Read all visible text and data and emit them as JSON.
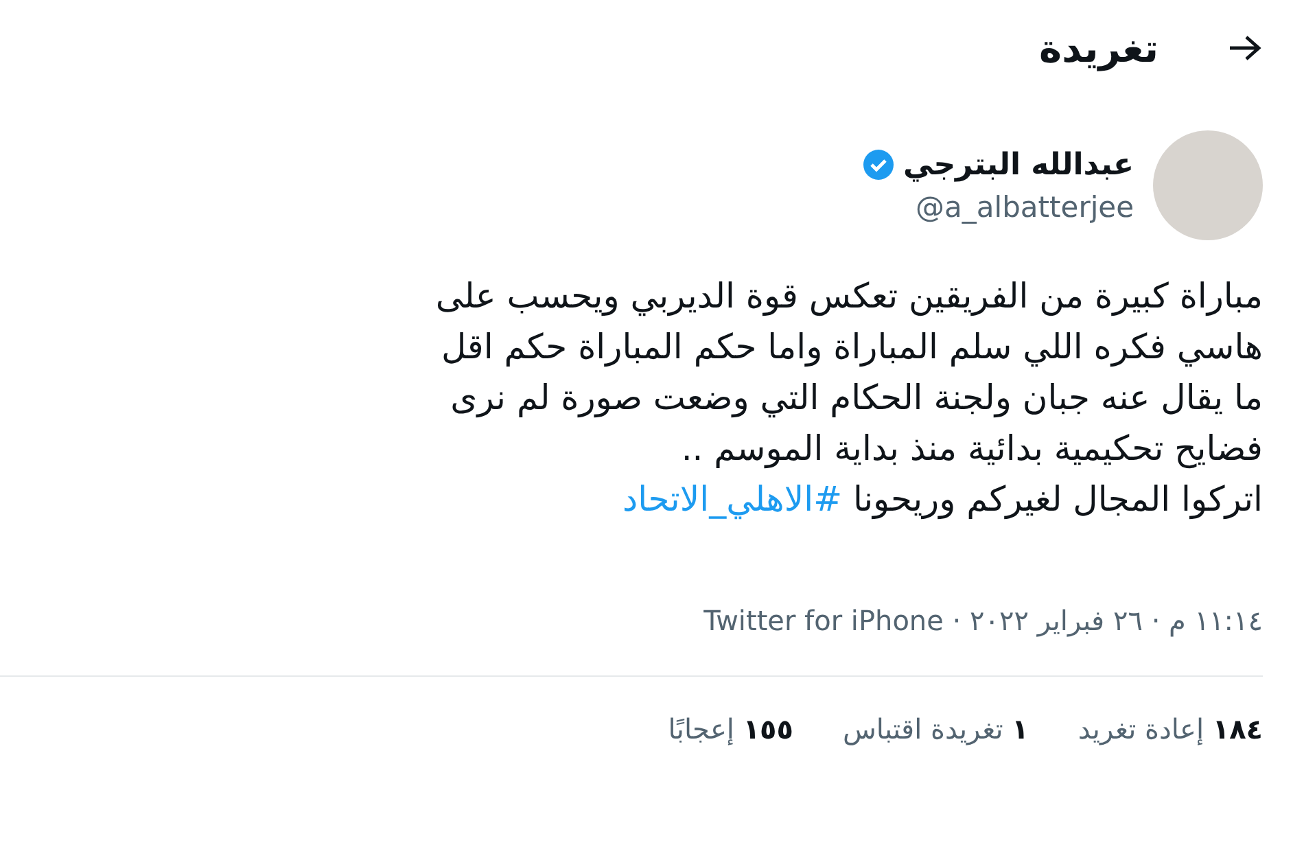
{
  "header": {
    "title": "تغريدة"
  },
  "author": {
    "name": "عبدالله البترجي",
    "handle": "@a_albatterjee",
    "verified": true
  },
  "tweet": {
    "lines": [
      "مباراة كبيرة من الفريقين تعكس قوة الديربي ويحسب على",
      "هاسي فكره اللي سلم المباراة واما حكم المباراة حكم اقل",
      "ما يقال عنه جبان ولجنة الحكام التي وضعت صورة لم نرى",
      "فضايح تحكيمية بدائية منذ بداية الموسم .."
    ],
    "last_line": "اتركوا المجال لغيركم وريحونا",
    "hashtag": "#الاهلي_الاتحاد"
  },
  "meta": "١١:١٤ م · ٢٦ فبراير ٢٠٢٢ · Twitter for iPhone",
  "stats": [
    {
      "count": "١٨٤",
      "label": "إعادة تغريد"
    },
    {
      "count": "١",
      "label": "تغريدة اقتباس"
    },
    {
      "count": "١٥٥",
      "label": "إعجابًا"
    }
  ]
}
